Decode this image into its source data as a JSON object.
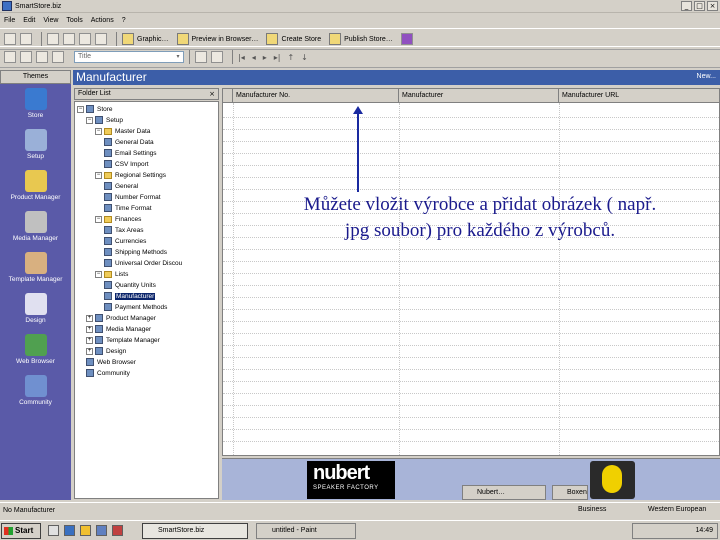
{
  "window": {
    "title": "SmartStore.biz",
    "btn_min": "_",
    "btn_max": "□",
    "btn_close": "×"
  },
  "menu": [
    "File",
    "Edit",
    "View",
    "Tools",
    "Actions",
    "?"
  ],
  "toolbar": {
    "buttons": [
      "Graphic…",
      "Preview in Browser…",
      "Create Store",
      "Publish Store…"
    ]
  },
  "toolbar2": {
    "filter_value": "Title",
    "dd": "▾",
    "nav": [
      "|◂",
      "◂",
      "▸",
      "▸|",
      "↑",
      "↓"
    ]
  },
  "left": {
    "header": "Themes",
    "shortcuts": [
      {
        "label": "Store",
        "color": "#3a7ad0"
      },
      {
        "label": "Setup",
        "color": "#9ab0d8"
      },
      {
        "label": "Product Manager",
        "color": "#e8c850"
      },
      {
        "label": "Media Manager",
        "color": "#c0c0c0"
      },
      {
        "label": "Template Manager",
        "color": "#d8b080"
      },
      {
        "label": "Design",
        "color": "#e0e0f0"
      },
      {
        "label": "Web Browser",
        "color": "#50a050"
      },
      {
        "label": "Community",
        "color": "#7090d0"
      }
    ]
  },
  "header": {
    "title": "Manufacturer",
    "new_label": "New..."
  },
  "folders": {
    "title": "Folder List",
    "close": "×",
    "items": [
      {
        "label": "Store",
        "exp": "−",
        "kind": "g"
      },
      {
        "label": "Setup",
        "exp": "−",
        "kind": "g"
      },
      {
        "label": "Master Data",
        "exp": "−",
        "kind": "f"
      },
      {
        "label": "General Data",
        "exp": "",
        "kind": "g"
      },
      {
        "label": "Email Settings",
        "exp": "",
        "kind": "g"
      },
      {
        "label": "CSV Import",
        "exp": "",
        "kind": "g"
      },
      {
        "label": "Regional Settings",
        "exp": "−",
        "kind": "f"
      },
      {
        "label": "General",
        "exp": "",
        "kind": "g"
      },
      {
        "label": "Number Format",
        "exp": "",
        "kind": "g"
      },
      {
        "label": "Time Format",
        "exp": "",
        "kind": "g"
      },
      {
        "label": "Finances",
        "exp": "−",
        "kind": "f"
      },
      {
        "label": "Tax Areas",
        "exp": "",
        "kind": "g"
      },
      {
        "label": "Currencies",
        "exp": "",
        "kind": "g"
      },
      {
        "label": "Shipping Methods",
        "exp": "",
        "kind": "g"
      },
      {
        "label": "Universal Order Discou",
        "exp": "",
        "kind": "g"
      },
      {
        "label": "Lists",
        "exp": "−",
        "kind": "f"
      },
      {
        "label": "Quantity Units",
        "exp": "",
        "kind": "g"
      },
      {
        "label": "Manufacturer",
        "exp": "",
        "kind": "g",
        "selected": true
      },
      {
        "label": "Payment Methods",
        "exp": "",
        "kind": "g"
      },
      {
        "label": "Product Manager",
        "exp": "+",
        "kind": "g"
      },
      {
        "label": "Media Manager",
        "exp": "+",
        "kind": "g"
      },
      {
        "label": "Template Manager",
        "exp": "+",
        "kind": "g"
      },
      {
        "label": "Design",
        "exp": "+",
        "kind": "g"
      },
      {
        "label": "Web Browser",
        "exp": "",
        "kind": "g"
      },
      {
        "label": "Community",
        "exp": "",
        "kind": "g"
      }
    ]
  },
  "grid": {
    "columns": [
      "Manufacturer No.",
      "Manufacturer",
      "Manufacturer URL"
    ]
  },
  "annotation": {
    "text": "Můžete vložit výrobce a přidat obrázek ( např. jpg soubor) pro každého z výrobců."
  },
  "banner": {
    "brand": "nubert",
    "tagline": "SPEAKER FACTORY",
    "tabs": [
      "Nubert…",
      "Boxen"
    ]
  },
  "status": {
    "left": "No Manufacturer",
    "mid": "Business",
    "right": "Western European"
  },
  "taskbar": {
    "start": "Start",
    "tasks": [
      "SmartStore.biz",
      "untitled - Paint"
    ],
    "clock": "14:49"
  }
}
